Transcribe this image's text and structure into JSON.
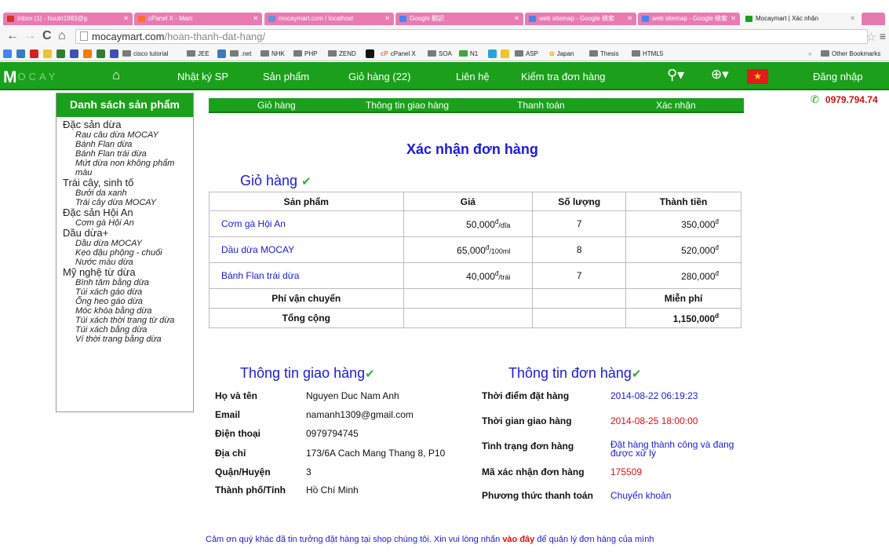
{
  "browser": {
    "tabs": [
      {
        "title": "Inbox (1) - huutri1983@g",
        "icon_color": "#d93025"
      },
      {
        "title": "cPanel X - Main",
        "icon_color": "#ff6c2c"
      },
      {
        "title": "mocaymart.com / localhost",
        "icon_color": "#6b8fd6"
      },
      {
        "title": "Google 翻訳",
        "icon_color": "#4285f4"
      },
      {
        "title": "web sitemap - Google 検索",
        "icon_color": "#4285f4"
      },
      {
        "title": "web sitemap - Google 検索",
        "icon_color": "#4285f4"
      },
      {
        "title": "Mocaymart | Xác nhận",
        "icon_color": "#1ba01b"
      }
    ],
    "url_host": "mocaymart.com",
    "url_path": "/hoan-thanh-dat-hang/",
    "bookmarks": [
      "cisco tutorial",
      "JEE",
      ".net",
      "NHK",
      "PHP",
      "ZEND",
      "cPanel X",
      "SOA",
      "N1",
      "ASP",
      "Japan",
      "Thesis",
      "HTML5",
      "Other Bookmarks"
    ]
  },
  "header": {
    "logo": "M",
    "logo_rest": "OCAY",
    "nav": [
      "Nhật ký SP",
      "Sản phẩm",
      "Giỏ hàng (22)",
      "Liên hệ",
      "Kiểm tra đơn hàng"
    ],
    "login": "Đăng nhập",
    "phone": "0979.794.74"
  },
  "sidebar": {
    "title": "Danh sách sản phẩm",
    "categories": [
      {
        "name": "Đặc sản dừa",
        "items": [
          "Rau câu dừa MOCAY",
          "Bánh Flan dừa",
          "Bánh Flan trái dừa",
          "Mứt dừa non không phẩm màu"
        ]
      },
      {
        "name": "Trái cây, sinh tố",
        "items": [
          "Bưởi da xanh",
          "Trái cây dừa MOCAY"
        ]
      },
      {
        "name": "Đặc sản Hội An",
        "items": [
          "Cơm gà Hội An"
        ]
      },
      {
        "name": "Dầu dừa+",
        "items": [
          "Dầu dừa MOCAY",
          "Kẹo đậu phộng - chuối",
          "Nước màu dừa"
        ]
      },
      {
        "name": "Mỹ nghệ từ dừa",
        "items": [
          "Bình tăm bằng dừa",
          "Túi xách gáo dừa",
          "Ống heo gáo dừa",
          "Móc khóa bằng dừa",
          "Túi xách thời trang từ dừa",
          "Túi xách bằng dừa",
          "Ví thời trang bằng dừa"
        ]
      }
    ]
  },
  "steps": [
    "Giỏ hàng",
    "Thông tin giao hàng",
    "Thanh toán",
    "Xác nhận"
  ],
  "main": {
    "title": "Xác nhận đơn hàng",
    "cart_title": "Giỏ hàng",
    "table_headers": [
      "Sản phẩm",
      "Giá",
      "Số lượng",
      "Thành tiền"
    ],
    "items": [
      {
        "name": "Cơm gà Hội An",
        "price": "50,000",
        "unit": "/dĩa",
        "qty": "7",
        "total": "350,000"
      },
      {
        "name": "Dầu dừa MOCAY",
        "price": "65,000",
        "unit": "/100ml",
        "qty": "8",
        "total": "520,000"
      },
      {
        "name": "Bánh Flan trái dừa",
        "price": "40,000",
        "unit": "/trái",
        "qty": "7",
        "total": "280,000"
      }
    ],
    "currency": "đ",
    "shipping_label": "Phí vận chuyển",
    "shipping_value": "Miễn phí",
    "total_label": "Tổng cộng",
    "total_value": "1,150,000"
  },
  "delivery": {
    "title": "Thông tin giao hàng",
    "rows": [
      {
        "label": "Họ và tên",
        "value": "Nguyen Duc Nam Anh"
      },
      {
        "label": "Email",
        "value": "namanh1309@gmail.com"
      },
      {
        "label": "Điện thoại",
        "value": "0979794745"
      },
      {
        "label": "Địa chỉ",
        "value": "173/6A Cach Mang Thang 8, P10"
      },
      {
        "label": "Quận/Huyện",
        "value": "3"
      },
      {
        "label": "Thành phố/Tỉnh",
        "value": "Hồ Chí Minh"
      }
    ]
  },
  "order": {
    "title": "Thông tin đơn hàng",
    "rows": [
      {
        "label": "Thời điểm đặt hàng",
        "value": "2014-08-22 06:19:23"
      },
      {
        "label": "Thời gian giao hàng",
        "value": "2014-08-25 18:00:00"
      },
      {
        "label": "Tình trạng đơn hàng",
        "value": "Đặt hàng thành công và đang được xử lý"
      },
      {
        "label": "Mã xác nhận đơn hàng",
        "value": "175509"
      },
      {
        "label": "Phương thức thanh toán",
        "value": "Chuyển khoản"
      }
    ]
  },
  "footer": {
    "before": "Cảm ơn quý khác đã tin tưởng đặt hàng tại shop chúng tôi. Xin vui lòng nhấn ",
    "link": "vào đây",
    "after": " để quản lý đơn hàng của mình"
  }
}
